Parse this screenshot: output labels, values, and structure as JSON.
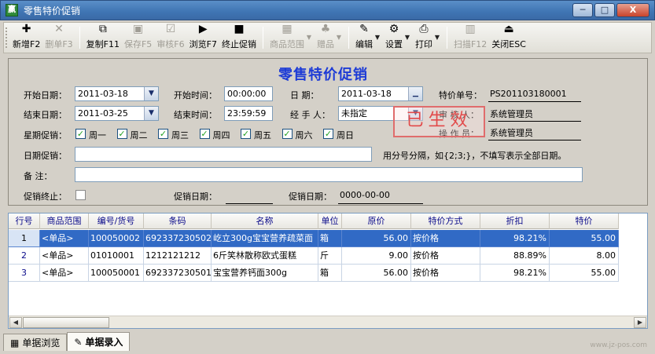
{
  "window": {
    "title": "零售特价促销",
    "app_icon_text": "赢",
    "min_label": "─",
    "max_label": "□",
    "close_label": "X"
  },
  "toolbar": {
    "items": [
      {
        "label": "新增F2",
        "icon": "new-doc-icon",
        "glyph": "✚",
        "enabled": true
      },
      {
        "label": "删单F3",
        "icon": "delete-icon",
        "glyph": "✕",
        "enabled": false
      },
      {
        "label": "复制F11",
        "icon": "copy-icon",
        "glyph": "⧉",
        "enabled": true
      },
      {
        "label": "保存F5",
        "icon": "save-icon",
        "glyph": "▣",
        "enabled": false
      },
      {
        "label": "审核F6",
        "icon": "approve-icon",
        "glyph": "☑",
        "enabled": false
      },
      {
        "label": "浏览F7",
        "icon": "browse-icon",
        "glyph": "▶",
        "enabled": true
      },
      {
        "label": "终止促销",
        "icon": "stop-promo-icon",
        "glyph": "■",
        "enabled": true
      },
      {
        "label": "商品范围",
        "icon": "product-range-icon",
        "glyph": "▦",
        "enabled": false
      },
      {
        "label": "赠品",
        "icon": "gift-icon",
        "glyph": "♣",
        "enabled": false
      },
      {
        "label": "编辑",
        "icon": "edit-icon",
        "glyph": "✎",
        "enabled": true
      },
      {
        "label": "设置",
        "icon": "settings-icon",
        "glyph": "⚙",
        "enabled": true
      },
      {
        "label": "打印",
        "icon": "print-icon",
        "glyph": "⎙",
        "enabled": true
      },
      {
        "label": "扫描F12",
        "icon": "barcode-icon",
        "glyph": "▥",
        "enabled": false
      },
      {
        "label": "关闭ESC",
        "icon": "close-door-icon",
        "glyph": "⏏",
        "enabled": true
      }
    ]
  },
  "form": {
    "title": "零售特价促销",
    "start_date_label": "开始日期：",
    "start_date": "2011-03-18",
    "end_date_label": "结束日期：",
    "end_date": "2011-03-25",
    "start_time_label": "开始时间：",
    "start_time": "00:00:00",
    "end_time_label": "结束时间：",
    "end_time": "23:59:59",
    "date_label": "日    期：",
    "date": "2011-03-18",
    "handler_label": "经 手 人：",
    "handler": "未指定",
    "doc_no_label": "特价单号：",
    "doc_no": "PS201103180001",
    "reviewer_label": "审 核 人：",
    "reviewer": "系统管理员",
    "operator_label": "操 作 员：",
    "operator": "系统管理员",
    "weekday_label": "星期促销：",
    "weekdays": [
      "周一",
      "周二",
      "周三",
      "周四",
      "周五",
      "周六",
      "周日"
    ],
    "date_promo_label": "日期促销：",
    "date_promo_value": "",
    "date_promo_hint": "用分号分隔，如{2;3;}，不填写表示全部日期。",
    "remark_label": "备    注：",
    "remark_value": "",
    "promo_end_label": "促销终止：",
    "promo_date1_label": "促销日期：",
    "promo_date1": "",
    "promo_date2_label": "促销日期：",
    "promo_date2": "0000-00-00",
    "stamp": "已生效"
  },
  "grid": {
    "columns": [
      "行号",
      "商品范围",
      "编号/货号",
      "条码",
      "名称",
      "单位",
      "原价",
      "特价方式",
      "折扣",
      "特价"
    ],
    "rows": [
      {
        "no": "1",
        "range": "<单品>",
        "code": "100050002",
        "barcode": "6923372305020",
        "name": "屹立300g宝宝营养疏菜面",
        "unit": "箱",
        "orig": "56.00",
        "method": "按价格",
        "discount": "98.21%",
        "price": "55.00",
        "selected": true
      },
      {
        "no": "2",
        "range": "<单品>",
        "code": "01010001",
        "barcode": "1212121212",
        "name": "6斤笑林散称欧式蛋糕",
        "unit": "斤",
        "orig": "9.00",
        "method": "按价格",
        "discount": "88.89%",
        "price": "8.00",
        "selected": false
      },
      {
        "no": "3",
        "range": "<单品>",
        "code": "100050001",
        "barcode": "6923372305013",
        "name": "宝宝营养钙面300g",
        "unit": "箱",
        "orig": "56.00",
        "method": "按价格",
        "discount": "98.21%",
        "price": "55.00",
        "selected": false
      }
    ]
  },
  "tabs": [
    {
      "label": "单据浏览",
      "icon": "grid-icon",
      "glyph": "▦",
      "active": false
    },
    {
      "label": "单据录入",
      "icon": "pen-icon",
      "glyph": "✎",
      "active": true
    }
  ],
  "watermark": "www.jz-pos.com"
}
